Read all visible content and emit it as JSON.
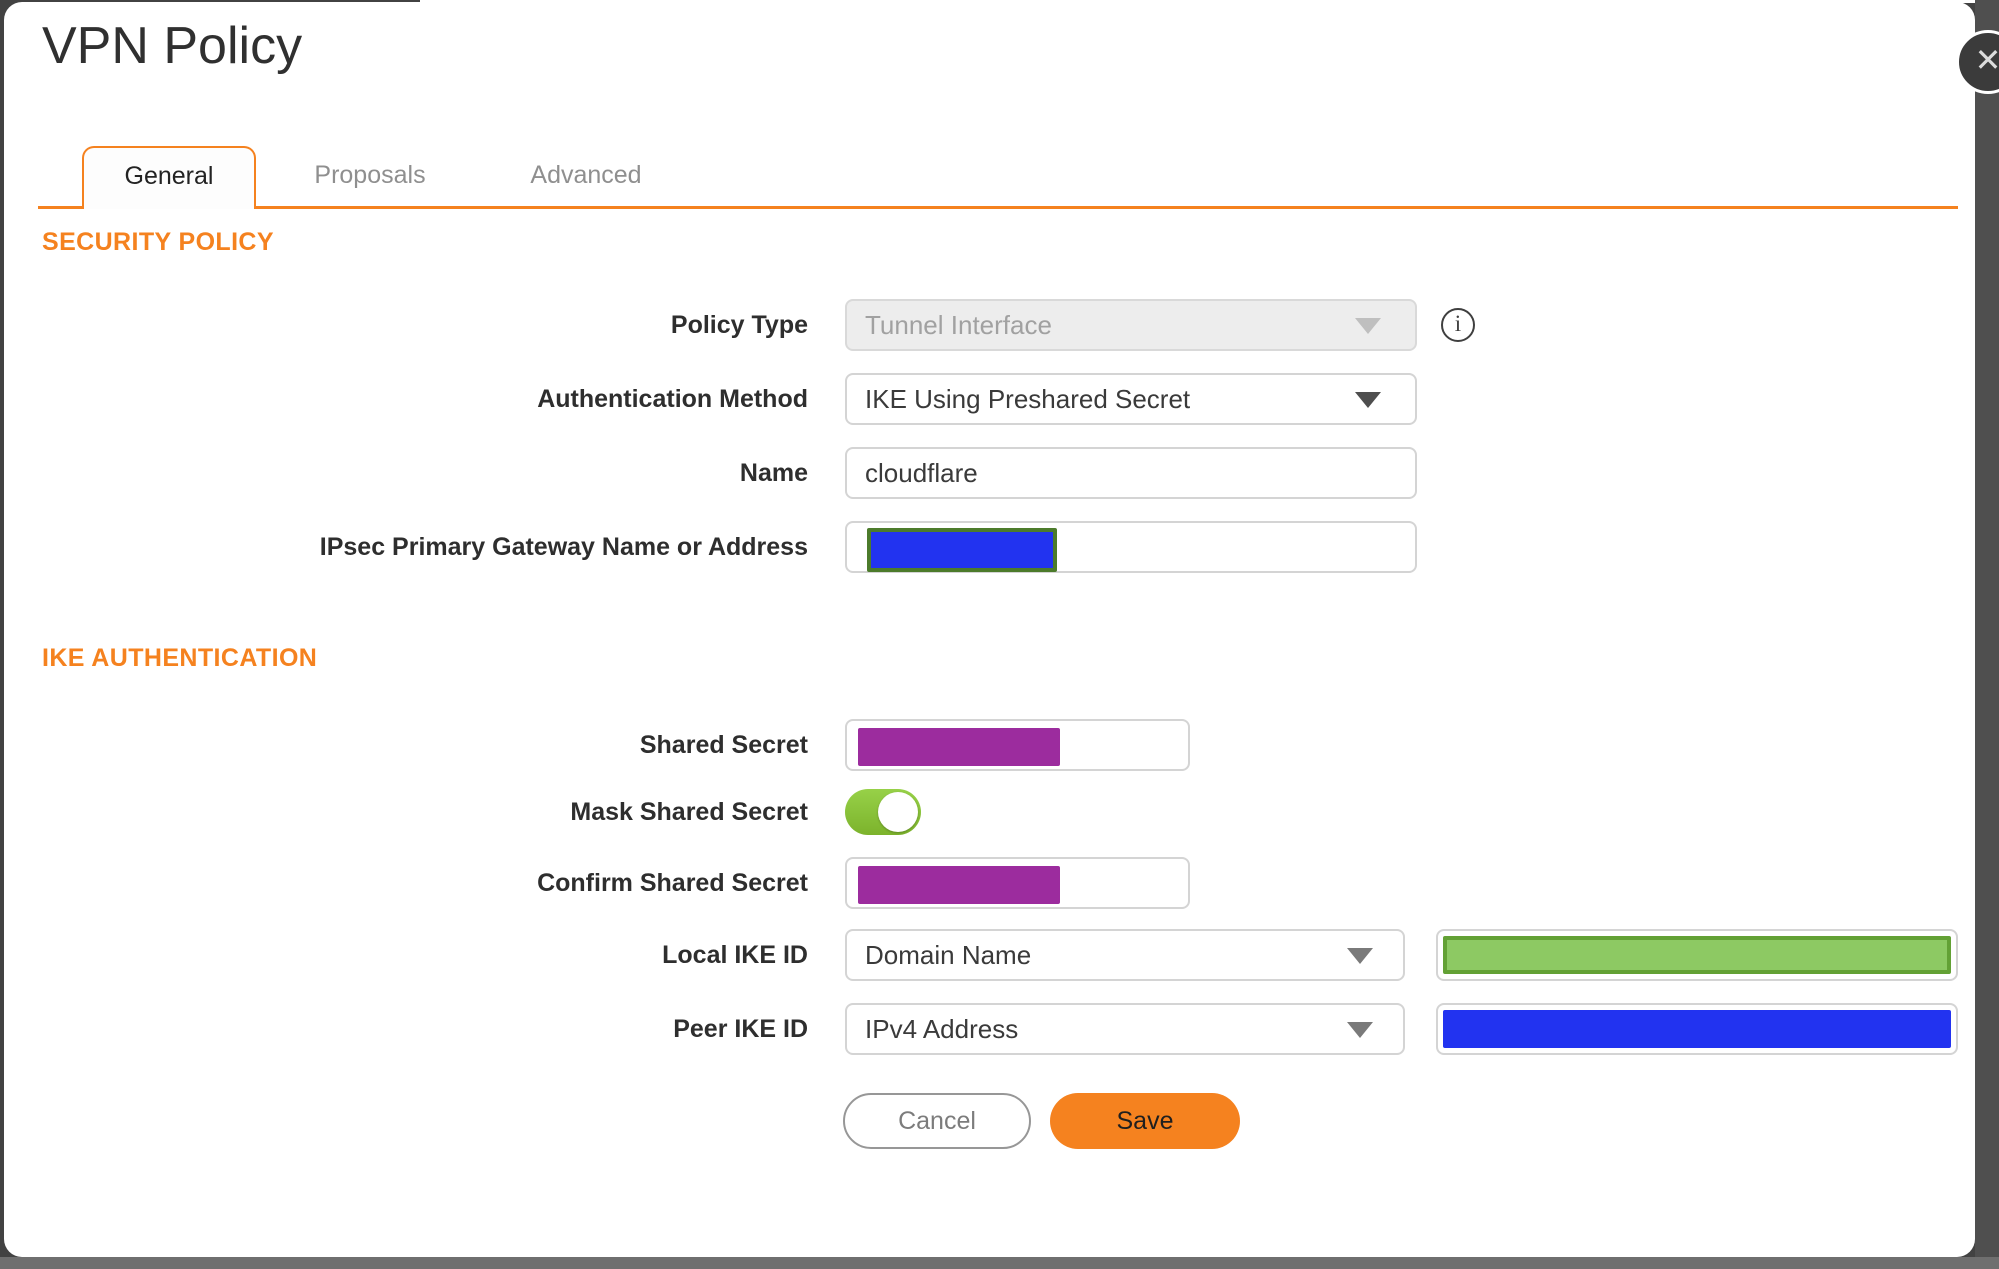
{
  "dialog": {
    "title": "VPN Policy",
    "close_label": "✕",
    "tabs": [
      {
        "label": "General",
        "active": true
      },
      {
        "label": "Proposals",
        "active": false
      },
      {
        "label": "Advanced",
        "active": false
      }
    ]
  },
  "icons": {
    "info": "i"
  },
  "security_policy": {
    "heading": "SECURITY POLICY",
    "policy_type": {
      "label": "Policy Type",
      "value": "Tunnel Interface",
      "disabled": true
    },
    "authentication_method": {
      "label": "Authentication Method",
      "value": "IKE Using Preshared Secret"
    },
    "name": {
      "label": "Name",
      "value": "cloudflare"
    },
    "gateway": {
      "label": "IPsec Primary Gateway Name or Address",
      "redaction_color": "#2233F0",
      "redaction_border": "#4C7B2B"
    }
  },
  "ike_authentication": {
    "heading": "IKE AUTHENTICATION",
    "shared_secret": {
      "label": "Shared Secret",
      "redaction_color": "#9C2C9E"
    },
    "mask_shared_secret": {
      "label": "Mask Shared Secret",
      "state": "on"
    },
    "confirm_shared_secret": {
      "label": "Confirm Shared Secret",
      "redaction_color": "#9C2C9E"
    },
    "local_ike_id": {
      "label": "Local IKE ID",
      "selected": "Domain Name",
      "redaction_color": "#8DC963",
      "redaction_border": "#63A135"
    },
    "peer_ike_id": {
      "label": "Peer IKE ID",
      "selected": "IPv4 Address",
      "redaction_color": "#2233F0"
    }
  },
  "actions": {
    "cancel": "Cancel",
    "save": "Save"
  },
  "colors": {
    "accent_orange": "#F5821F",
    "toggle_green": "#8CC63F",
    "secret_purple": "#9C2C9E",
    "redaction_blue": "#2233F0",
    "redaction_green": "#8DC963",
    "frame_gray": "#4F4F4F"
  }
}
